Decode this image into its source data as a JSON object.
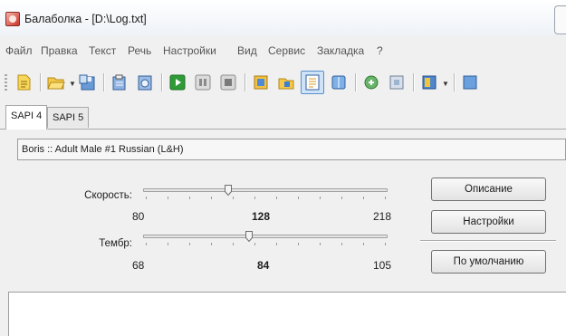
{
  "window": {
    "title": "Балаболка - [D:\\Log.txt]"
  },
  "menu": [
    "Файл",
    "Правка",
    "Текст",
    "Речь",
    "Настройки",
    "Вид",
    "Сервис",
    "Закладка",
    "?"
  ],
  "tabs": [
    {
      "label": "SAPI 4",
      "active": true
    },
    {
      "label": "SAPI 5",
      "active": false
    }
  ],
  "voice": {
    "selected": "Boris :: Adult Male #1 Russian (L&H)"
  },
  "rate": {
    "label": "Скорость:",
    "min": "80",
    "value": "128",
    "max": "218",
    "level": 128
  },
  "pitch": {
    "label": "Тембр:",
    "min": "68",
    "value": "84",
    "max": "105",
    "level": 84
  },
  "buttons": {
    "description": "Описание",
    "settings": "Настройки",
    "defaults": "По умолчанию"
  },
  "colors": {
    "accent": "#5a8fc8",
    "play_green": "#2f9b37"
  },
  "toolbar_icons": [
    "new-document-icon",
    "open-folder-icon",
    "save-icon",
    "read-clipboard-icon",
    "read-file-icon",
    "play-icon",
    "pause-icon",
    "stop-icon",
    "speak-selection-icon",
    "save-audio-icon",
    "text-window-icon",
    "split-file-icon",
    "convert-icon",
    "export-icon",
    "dictionary-icon",
    "more-icon"
  ]
}
